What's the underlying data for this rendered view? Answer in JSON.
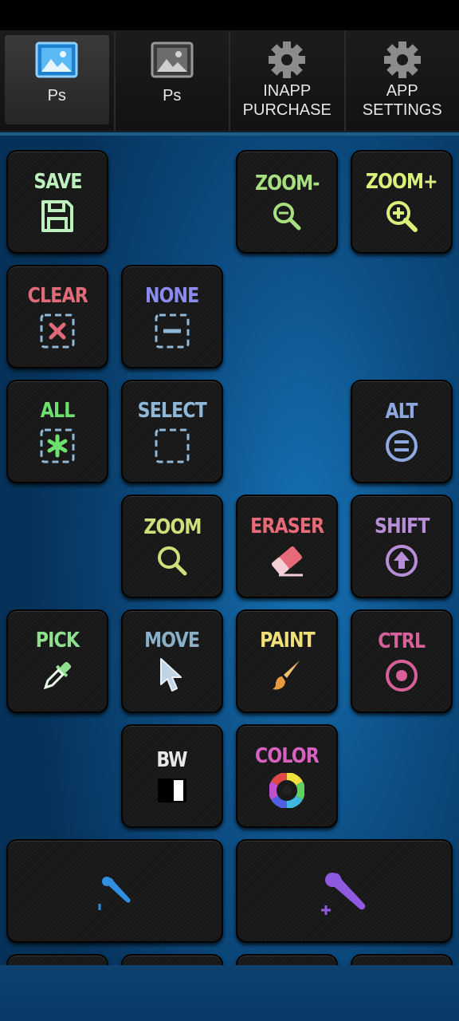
{
  "tabs": [
    {
      "label": "Ps",
      "icon": "image-icon-active",
      "active": true
    },
    {
      "label": "Ps",
      "icon": "image-icon",
      "active": false
    },
    {
      "label_line1": "INAPP",
      "label_line2": "PURCHASE",
      "icon": "gear-icon"
    },
    {
      "label_line1": "APP",
      "label_line2": "SETTINGS",
      "icon": "gear-icon"
    }
  ],
  "buttons": {
    "save": {
      "label": "SAVE",
      "color": "#bdf0bd",
      "icon": "floppy-disk-icon"
    },
    "zoom_minus": {
      "label": "ZOOM-",
      "color": "#a8e080",
      "icon": "zoom-out-icon"
    },
    "zoom_plus": {
      "label": "ZOOM+",
      "color": "#d9f07a",
      "icon": "zoom-in-icon"
    },
    "clear": {
      "label": "CLEAR",
      "color": "#e06b78",
      "icon": "clear-selection-icon"
    },
    "none": {
      "label": "NONE",
      "color": "#8c8cf0",
      "icon": "deselect-icon"
    },
    "all": {
      "label": "ALL",
      "color": "#6ee06e",
      "icon": "select-all-icon"
    },
    "select": {
      "label": "SELECT",
      "color": "#8fb8d8",
      "icon": "marquee-select-icon"
    },
    "alt": {
      "label": "ALT",
      "color": "#8ea8e0",
      "icon": "alt-key-icon"
    },
    "zoom": {
      "label": "ZOOM",
      "color": "#cfe07a",
      "icon": "magnifier-icon"
    },
    "eraser": {
      "label": "ERASER",
      "color": "#e66a78",
      "icon": "eraser-icon"
    },
    "shift": {
      "label": "SHIFT",
      "color": "#b88ed8",
      "icon": "shift-key-icon"
    },
    "pick": {
      "label": "PICK",
      "color": "#8ee08e",
      "icon": "eyedropper-icon"
    },
    "move": {
      "label": "MOVE",
      "color": "#8ab0c8",
      "icon": "cursor-arrow-icon"
    },
    "paint": {
      "label": "PAINT",
      "color": "#f0e07a",
      "icon": "paintbrush-icon"
    },
    "ctrl": {
      "label": "CTRL",
      "color": "#d8609a",
      "icon": "ctrl-key-icon"
    },
    "bw": {
      "label": "BW",
      "color": "#e8e8e8",
      "icon": "black-white-icon"
    },
    "color": {
      "label": "COLOR",
      "color": "#d860c0",
      "icon": "color-wheel-icon"
    },
    "brush_smaller": {
      "label": "",
      "color": "#2f8fe0",
      "icon": "brush-size-decrease-icon"
    },
    "brush_larger": {
      "label": "",
      "color": "#8e5ae0",
      "icon": "brush-size-increase-icon"
    }
  }
}
